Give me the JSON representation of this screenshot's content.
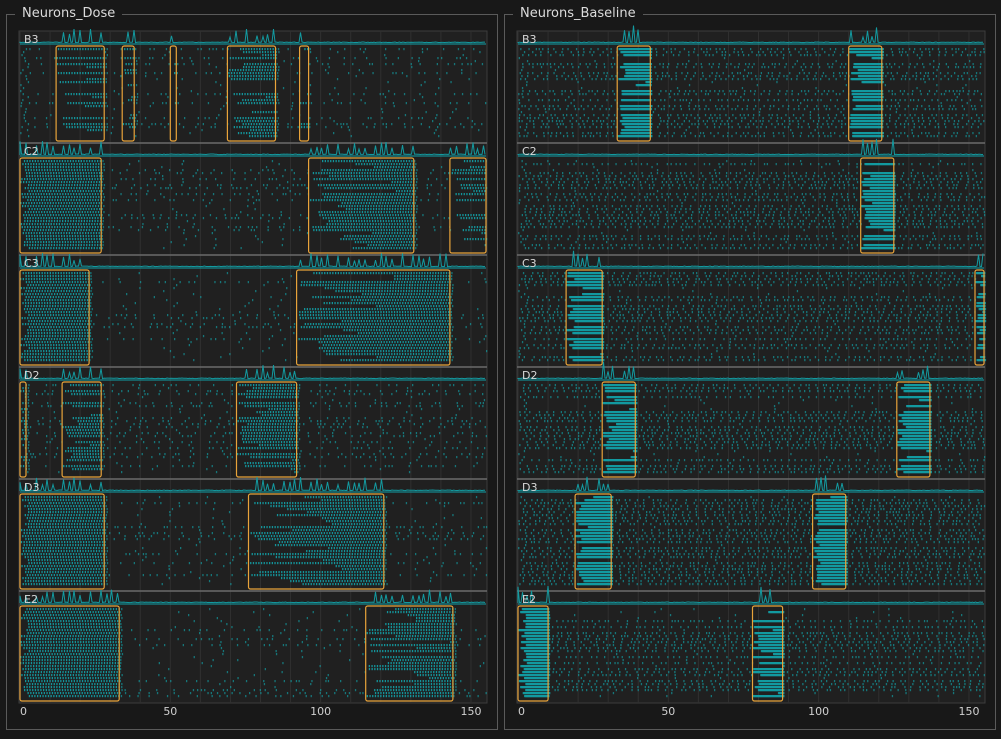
{
  "panels": [
    {
      "title": "Neurons_Dose",
      "theme": "dose",
      "axis": {
        "xlim": [
          0,
          155
        ],
        "ticks": [
          0,
          50,
          100,
          150
        ]
      },
      "wells": [
        {
          "label": "B3",
          "bursts": [
            [
              12,
              28
            ],
            [
              34,
              38
            ],
            [
              50,
              52
            ],
            [
              69,
              85
            ],
            [
              93,
              96
            ]
          ]
        },
        {
          "label": "C2",
          "bursts": [
            [
              0,
              27
            ],
            [
              96,
              131
            ],
            [
              143,
              158
            ]
          ]
        },
        {
          "label": "C3",
          "bursts": [
            [
              0,
              23
            ],
            [
              92,
              143
            ]
          ]
        },
        {
          "label": "D2",
          "bursts": [
            [
              0,
              2
            ],
            [
              14,
              27
            ],
            [
              72,
              92
            ]
          ]
        },
        {
          "label": "D3",
          "bursts": [
            [
              0,
              28
            ],
            [
              76,
              121
            ]
          ]
        },
        {
          "label": "E2",
          "bursts": [
            [
              0,
              33
            ],
            [
              115,
              144
            ]
          ]
        }
      ]
    },
    {
      "title": "Neurons_Baseline",
      "theme": "baseline",
      "axis": {
        "xlim": [
          0,
          155
        ],
        "ticks": [
          0,
          50,
          100,
          150
        ]
      },
      "wells": [
        {
          "label": "B3",
          "bursts": [
            [
              33,
              44
            ],
            [
              110,
              121
            ]
          ]
        },
        {
          "label": "C2",
          "bursts": [
            [
              114,
              125
            ]
          ]
        },
        {
          "label": "C3",
          "bursts": [
            [
              16,
              28
            ],
            [
              152,
              156
            ]
          ]
        },
        {
          "label": "D2",
          "bursts": [
            [
              28,
              39
            ],
            [
              126,
              137
            ]
          ]
        },
        {
          "label": "D3",
          "bursts": [
            [
              19,
              31
            ],
            [
              98,
              109
            ]
          ]
        },
        {
          "label": "E2",
          "bursts": [
            [
              0,
              10
            ],
            [
              78,
              88
            ]
          ]
        }
      ]
    }
  ],
  "colors": {
    "background": "#181818",
    "plot_background": "#202020",
    "spike": "#139aa0",
    "burst_box": "#e8a33a",
    "grid": "#303030",
    "text": "#d0d0d0"
  }
}
